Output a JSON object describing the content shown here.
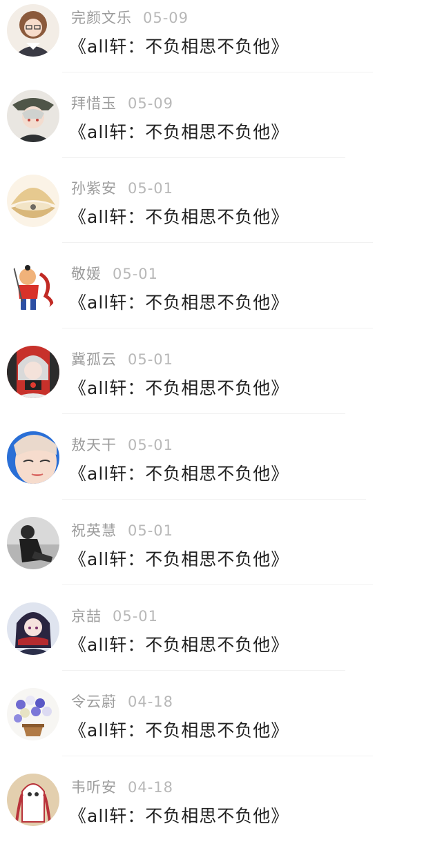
{
  "comments": [
    {
      "name": "完颜文乐",
      "date": "05-09",
      "title": "《all轩：不负相思不负他》",
      "avatar": "anime-girl-glasses-avatar"
    },
    {
      "name": "拜惜玉",
      "date": "05-09",
      "title": "《all轩：不负相思不负他》",
      "avatar": "anime-boy-hat-avatar"
    },
    {
      "name": "孙紫安",
      "date": "05-01",
      "title": "《all轩：不负相思不负他》",
      "avatar": "pearl-shell-avatar"
    },
    {
      "name": "敬媛",
      "date": "05-01",
      "title": "《all轩：不负相思不负他》",
      "avatar": "cartoon-warrior-avatar"
    },
    {
      "name": "冀孤云",
      "date": "05-01",
      "title": "《all轩：不负相思不负他》",
      "avatar": "anime-red-bg-avatar"
    },
    {
      "name": "敖天干",
      "date": "05-01",
      "title": "《all轩：不负相思不负他》",
      "avatar": "girl-blue-bg-avatar"
    },
    {
      "name": "祝英慧",
      "date": "05-01",
      "title": "《all轩：不负相思不负他》",
      "avatar": "bw-photo-avatar"
    },
    {
      "name": "京喆",
      "date": "05-01",
      "title": "《all轩：不负相思不负他》",
      "avatar": "anime-girl-scarf-avatar"
    },
    {
      "name": "令云蔚",
      "date": "04-18",
      "title": "《all轩：不负相思不负他》",
      "avatar": "flower-basket-avatar"
    },
    {
      "name": "韦听安",
      "date": "04-18",
      "title": "《all轩：不负相思不负他》",
      "avatar": "ghost-drawing-avatar"
    }
  ]
}
